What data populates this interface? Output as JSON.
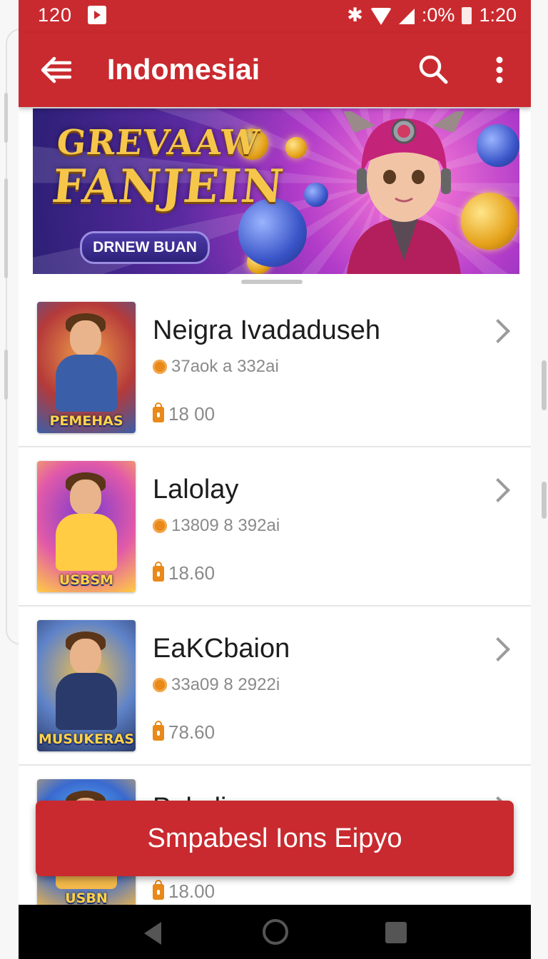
{
  "status_bar": {
    "time_left": "120",
    "battery_percent": ":0%",
    "time_right": "1:20"
  },
  "app_bar": {
    "title": "Indomesiai"
  },
  "banner": {
    "headline_line1": "GREVAAW",
    "headline_line2": "FANJEIN",
    "button_label": "DRNEW BUAN"
  },
  "games": [
    {
      "title": "Neigra Ιvadaduseh",
      "subtitle": "37aok a 332ai",
      "price": "18 00",
      "thumb_caption": "PEMEHAS",
      "thumb_colors": [
        "#f0a04a",
        "#b53a3a",
        "#3a5fa8"
      ]
    },
    {
      "title": "Lalolay",
      "subtitle": "13809 8 392ai",
      "price": "18.60",
      "thumb_caption": "USBSM",
      "thumb_colors": [
        "#7a3ad0",
        "#e25aa8",
        "#ffcc44"
      ]
    },
    {
      "title": "EaKCbaion",
      "subtitle": "33a09 8 2922i",
      "price": "78.60",
      "thumb_caption": "MUSUKERAS",
      "thumb_colors": [
        "#f4c04a",
        "#5f83c9",
        "#2a3a6a"
      ]
    },
    {
      "title": "Pekaliy",
      "subtitle": "",
      "price": "18.00",
      "thumb_caption": "USBN",
      "thumb_colors": [
        "#6bd1ff",
        "#3a6ad0",
        "#f2b84a"
      ]
    }
  ],
  "cta": {
    "label": "Smpabesl Ions Eipyo"
  }
}
